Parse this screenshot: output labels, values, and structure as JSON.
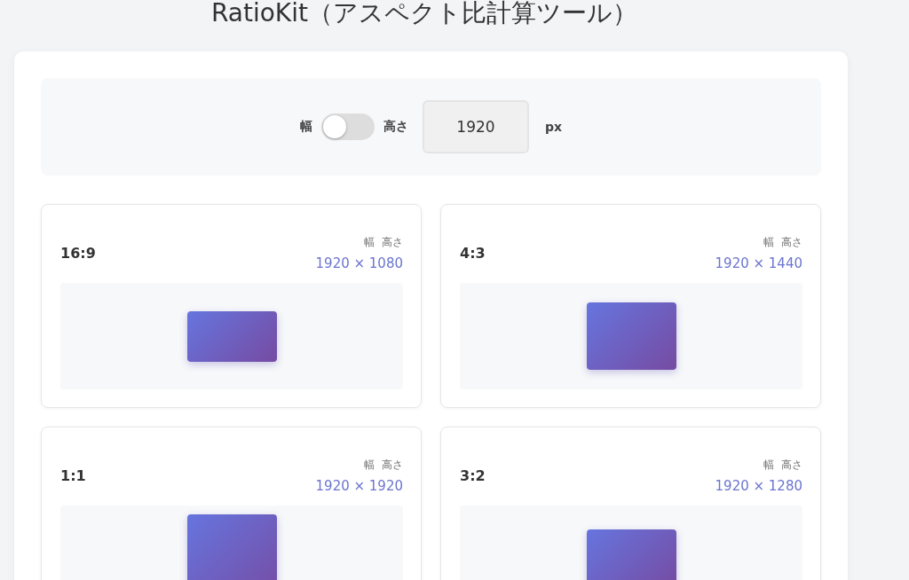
{
  "title": "RatioKit（アスペクト比計算ツール）",
  "controls": {
    "width_label": "幅",
    "toggle_on": false,
    "height_label": "高さ",
    "value": "1920",
    "unit": "px"
  },
  "ratios": [
    {
      "ratio": "16:9",
      "width_label": "幅",
      "height_label": "高さ",
      "dimensions": "1920 × 1080"
    },
    {
      "ratio": "4:3",
      "width_label": "幅",
      "height_label": "高さ",
      "dimensions": "1920 × 1440"
    },
    {
      "ratio": "1:1",
      "width_label": "幅",
      "height_label": "高さ",
      "dimensions": "1920 × 1920"
    },
    {
      "ratio": "3:2",
      "width_label": "幅",
      "height_label": "高さ",
      "dimensions": "1920 × 1280"
    }
  ]
}
